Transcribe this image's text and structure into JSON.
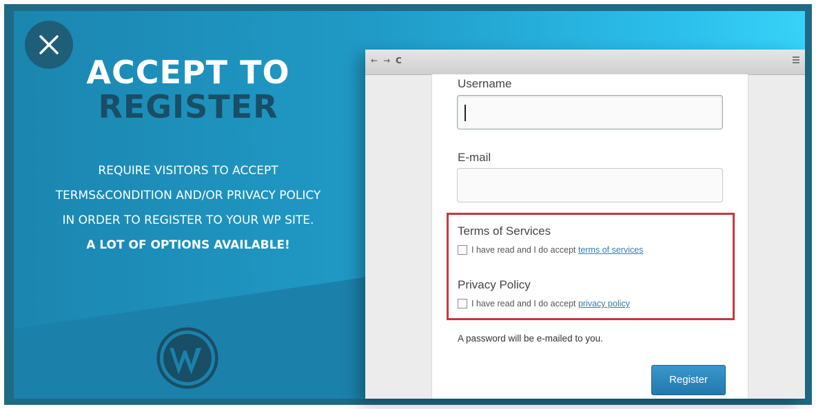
{
  "close": {
    "icon": "close-icon"
  },
  "promo": {
    "title_line1": "ACCEPT TO",
    "title_line2": "REGISTER",
    "description": [
      "REQUIRE VISITORS TO ACCEPT",
      "TERMS&CONDITION AND/OR PRIVACY POLICY",
      "IN ORDER TO REGISTER TO YOUR WP SITE.",
      "A LOT OF OPTIONS AVAILABLE!"
    ],
    "logo": "wordpress-logo"
  },
  "browser": {
    "toolbar": {
      "back_glyph": "←",
      "forward_glyph": "→",
      "reload_glyph": "C",
      "menu_icon": "hamburger-menu-icon"
    },
    "form": {
      "username_label": "Username",
      "username_value": "",
      "email_label": "E-mail",
      "email_value": "",
      "terms": {
        "title": "Terms of Services",
        "checkbox_text": "I have read and I do accept ",
        "link_text": "terms of services",
        "checked": false
      },
      "privacy": {
        "title": "Privacy Policy",
        "checkbox_text": "I have read and I do accept ",
        "link_text": "privacy policy",
        "checked": false
      },
      "note": "A password will be e-mailed to you.",
      "register_label": "Register"
    }
  },
  "colors": {
    "panel_blue": "#209ac6",
    "title_dark": "#184e66",
    "highlight_red": "#c0393f",
    "button_blue": "#2a86bc"
  }
}
